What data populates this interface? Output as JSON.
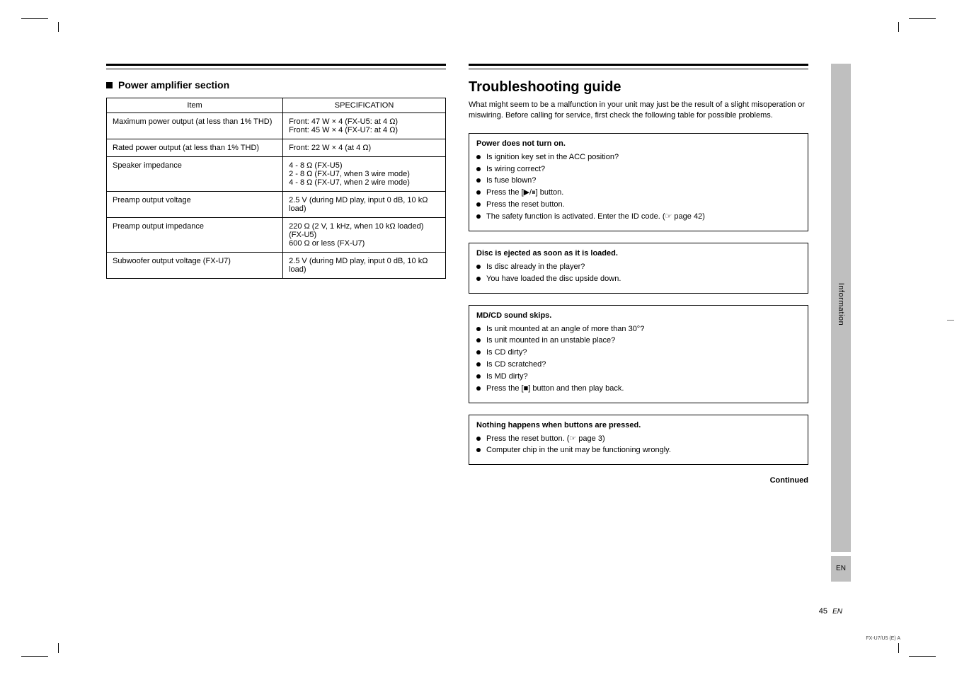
{
  "left": {
    "heading": "Power amplifier section",
    "table": {
      "headers": [
        "Item",
        "SPECIFICATION"
      ],
      "rows": [
        [
          "Maximum power output (at less than 1% THD)",
          "Front: 47 W × 4 (FX-U5: at 4 Ω)\nFront: 45 W × 4 (FX-U7: at 4 Ω)"
        ],
        [
          "Rated power output (at less than 1% THD)",
          "Front: 22 W × 4 (at 4 Ω)"
        ],
        [
          "Speaker impedance",
          "4 - 8 Ω (FX-U5)\n2 - 8 Ω (FX-U7, when 3 wire mode)\n4 - 8 Ω (FX-U7, when 2 wire mode)"
        ],
        [
          "Preamp output voltage",
          "2.5 V (during MD play, input 0 dB, 10 kΩ load)"
        ],
        [
          "Preamp output impedance",
          "220 Ω (2 V, 1 kHz, when 10 kΩ loaded)  (FX-U5)\n600 Ω or less (FX-U7)"
        ],
        [
          "Subwoofer output voltage (FX-U7)",
          "2.5 V (during MD play, input 0 dB, 10 kΩ load)"
        ]
      ]
    }
  },
  "right": {
    "title": "Troubleshooting guide",
    "intro": "What might seem to be a malfunction in your unit may just be the result of a slight misoperation or miswiring. Before calling for service, first check the following table for possible problems.",
    "boxes": [
      {
        "symptom": "Power does not turn on.",
        "items": [
          "Is ignition key set in the ACC position?",
          "Is wiring correct?",
          "Is fuse blown?",
          "Press the [▶/⏸] button.",
          "Press the reset button.",
          "The safety function is activated. Enter the ID code. (☞ page 42)"
        ]
      },
      {
        "symptom": "Disc is ejected as soon as it is loaded.",
        "items": [
          "Is disc already in the player?",
          "You have loaded the disc upside down."
        ]
      },
      {
        "symptom": "MD/CD sound skips.",
        "items": [
          "Is unit mounted at an angle of more than 30°?",
          "Is unit mounted in an unstable place?",
          "Is CD dirty?",
          "Is CD scratched?",
          "Is MD dirty?",
          "Press the [■] button and then play back."
        ]
      },
      {
        "symptom": "Nothing happens when buttons are pressed.",
        "items": [
          "Press the reset button. (☞ page 3)",
          "Computer chip in the unit may be functioning wrongly."
        ]
      }
    ],
    "continued": "Continued"
  },
  "sidebar": {
    "main": "Information",
    "short": "EN"
  },
  "page_number": "45",
  "page_lang": "EN",
  "footer": "FX-U7/U5 (E) A"
}
